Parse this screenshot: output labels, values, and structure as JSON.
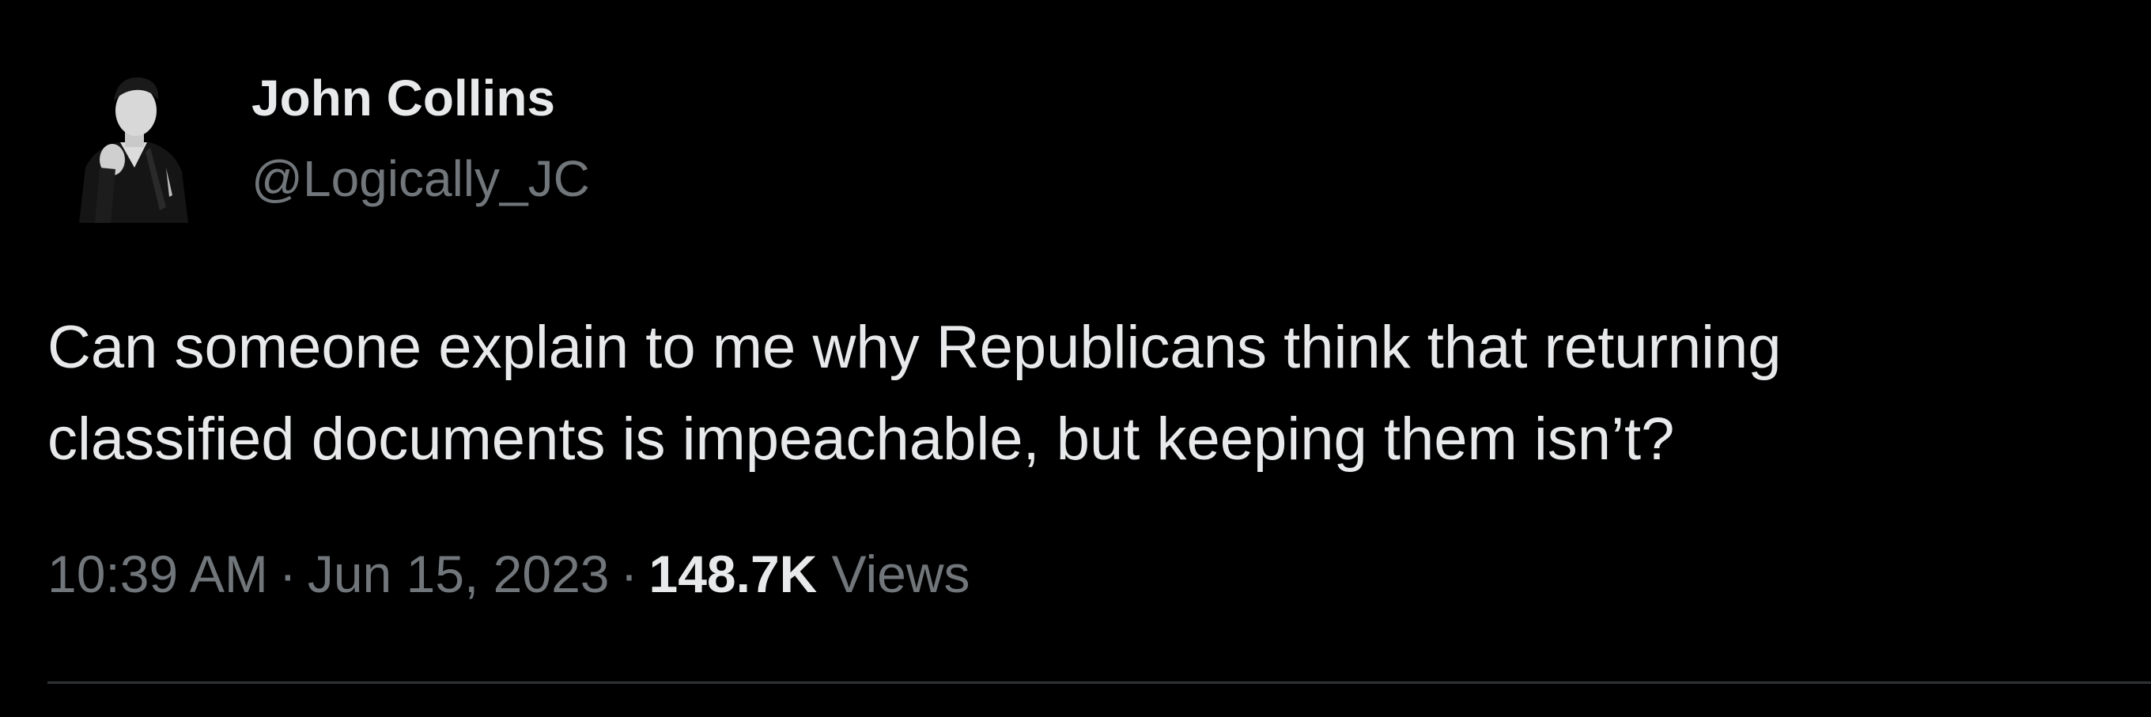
{
  "tweet": {
    "author": {
      "name": "John Collins",
      "handle": "@Logically_JC",
      "avatar_icon": "profile-photo"
    },
    "text_lines": [
      "Can someone explain to me why Republicans think that returning",
      "classified documents is impeachable, but keeping them isn’t?"
    ],
    "meta": {
      "time": "10:39 AM",
      "separator": "·",
      "date": "Jun 15, 2023",
      "views_count": "148.7K",
      "views_label": "Views"
    }
  },
  "colors": {
    "background": "#000000",
    "primary_text": "#e7e9ea",
    "secondary_text": "#71767b",
    "divider": "#2f3336"
  }
}
